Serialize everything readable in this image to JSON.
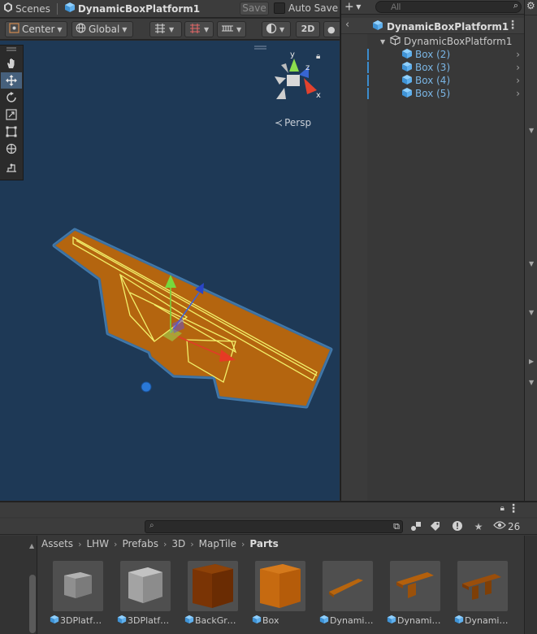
{
  "scene_bar": {
    "scenes_label": "Scenes",
    "prefab_name": "DynamicBoxPlatform1",
    "save_label": "Save",
    "autosave_label": "Auto Save"
  },
  "scene_toolbar": {
    "pivot_label": "Center",
    "space_label": "Global",
    "mode_2d_label": "2D"
  },
  "viewport": {
    "persp_label": "Persp",
    "gizmo_axes": {
      "y": "y",
      "z": "z",
      "x": "x"
    },
    "background_color": "#1e3956"
  },
  "hierarchy": {
    "search_placeholder": "All",
    "root_title": "DynamicBoxPlatform1",
    "items": [
      {
        "label": "DynamicBoxPlatform1"
      },
      {
        "label": "Box (2)"
      },
      {
        "label": "Box (3)"
      },
      {
        "label": "Box (4)"
      },
      {
        "label": "Box (5)"
      }
    ]
  },
  "project": {
    "hidden_count": "26",
    "breadcrumb": [
      "Assets",
      "LHW",
      "Prefabs",
      "3D",
      "MapTile",
      "Parts"
    ],
    "assets": [
      {
        "label": "3DPlatfor...",
        "color": "#8f8f8f"
      },
      {
        "label": "3DPlatfor...",
        "color": "#a3a3a3"
      },
      {
        "label": "BackGrou...",
        "color": "#7a3405"
      },
      {
        "label": "Box",
        "color": "#c66a10"
      },
      {
        "label": "DynamicB...",
        "color": "#b7650e"
      },
      {
        "label": "DynamicB...",
        "color": "#b4600c"
      },
      {
        "label": "DynamicB...",
        "color": "#8e430a"
      }
    ]
  },
  "colors": {
    "platform": "#b4650f",
    "selection_outline": "#f2f06a",
    "accent_blue": "#3b8ccd",
    "prefab_blue": "#7ab5e4"
  }
}
